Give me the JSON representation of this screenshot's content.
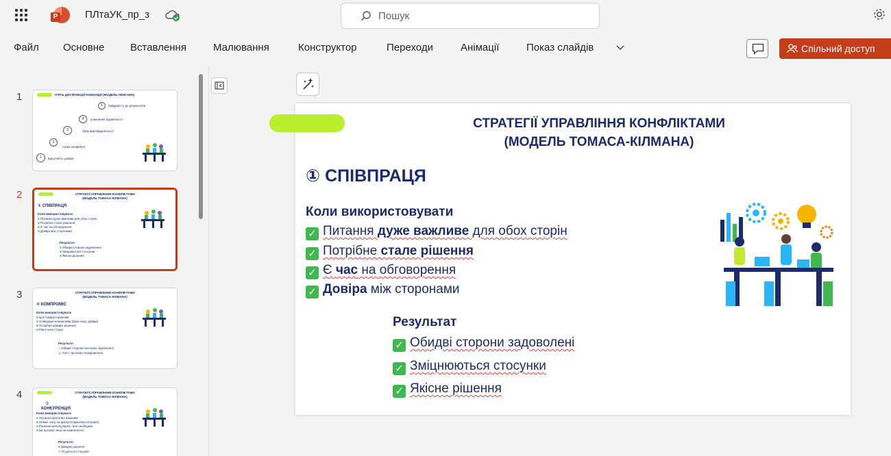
{
  "titlebar": {
    "doc_title": "ПЛтаУК_пр_з",
    "search_placeholder": "Пошук",
    "app_letter": "P"
  },
  "ribbon": {
    "tabs": [
      "Файл",
      "Основне",
      "Вставлення",
      "Малювання",
      "Конструктор",
      "Переходи",
      "Анімації",
      "Показ слайдів"
    ],
    "share_label": "Спільний доступ"
  },
  "colors": {
    "accent": "#c43e1c",
    "slide_text": "#1c2b6b",
    "highlight_mark": "#b8f02d",
    "check_green": "#3fb84e"
  },
  "thumbnails": [
    {
      "number": "1",
      "title": "П'ЯТЬ ДИСФУНКЦІЙ КОМАНДИ (МОДЕЛЬ ЛЕНСІОНІ)",
      "items": [
        "байдужість до результатів",
        "уникнення підзвітності",
        "брак відповідальності",
        "страх конфлікту",
        "відсутність довіри"
      ],
      "item_numbers": [
        "5",
        "4",
        "3",
        "2",
        "1"
      ]
    },
    {
      "number": "2",
      "title_line1": "СТРАТЕГІЇ УПРАВЛІННЯ КОНФЛІКТАМИ",
      "title_line2": "(МОДЕЛЬ ТОМАСА-КІЛМАНА)",
      "heading": "① СПІВПРАЦЯ",
      "when": "Коли використовувати",
      "bullets": [
        "Питання дуже важливе для обох сторін",
        "Потрібне стале рішення",
        "Є час на обговорення",
        "Довіра між сторонами"
      ],
      "result": "Результат",
      "results": [
        "Обидві сторони задоволені",
        "Зміцнюються стосунки",
        "Якісне рішення"
      ]
    },
    {
      "number": "3",
      "title_line1": "СТРАТЕГІЇ УПРАВЛІННЯ КОНФЛІКТАМИ",
      "title_line2": "(МОДЕЛЬ ТОМАСА-КІЛМАНА)",
      "heading": "② КОМПРОМІС",
      "when": "Коли використовувати",
      "bullets": [
        "Цілі помірно важливі",
        "Співпраця неможлива (брак часу, довіри)",
        "Потрібне швидке рішення",
        "Рівні сили сторін"
      ],
      "result": "Результат",
      "results": [
        "Обидві сторони частково задоволені",
        "Але і частково незадоволені"
      ]
    },
    {
      "number": "4",
      "title_line1": "СТРАТЕГІЇ УПРАВЛІННЯ КОНФЛІКТАМИ",
      "title_line2": "(МОДЕЛЬ ТОМАСА-КІЛМАНА)",
      "heading_num": "③",
      "heading": "КОНКУРЕНЦІЯ",
      "when": "Коли використовувати",
      "bullets": [
        "Питання критично важливе",
        "Немає часу на дискусії (кризова ситуація)",
        "Рішення непопулярне, але необхідне",
        "Ви експерт, інші не компетентні"
      ],
      "result": "Результат",
      "results": [
        "Швидке рішення",
        "Псуються стосунки"
      ]
    }
  ],
  "slide": {
    "title_line1": "СТРАТЕГІЇ УПРАВЛІННЯ КОНФЛІКТАМИ",
    "title_line2": "(МОДЕЛЬ ТОМАСА-КІЛМАНА)",
    "heading": "① СПІВПРАЦЯ",
    "when_label": "Коли використовувати",
    "bullets": [
      {
        "pre": "Питання ",
        "bold": "дуже важливе",
        "post": " для обох сторін"
      },
      {
        "pre": "Потрібне ",
        "bold": "стале рішення",
        "post": ""
      },
      {
        "pre": "Є ",
        "bold": "час",
        "post": " на обговорення"
      },
      {
        "pre": "",
        "bold": "Довіра",
        "post": " між сторонами"
      }
    ],
    "result_label": "Результат",
    "results": [
      "Обидві сторони задоволені",
      "Зміцнюються стосунки",
      "Якісне рішення"
    ]
  }
}
